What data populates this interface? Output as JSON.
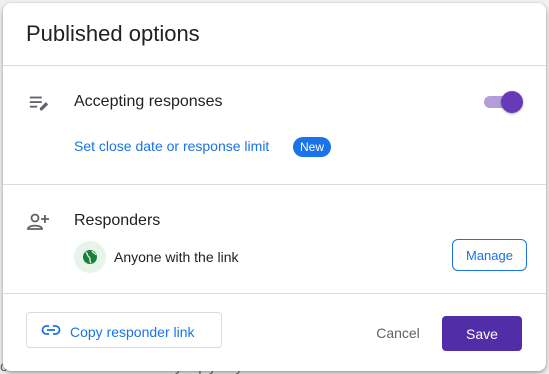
{
  "backdrop": {
    "partial_text": "our email address so we may reply to your comment"
  },
  "dialog": {
    "title": "Published options",
    "accepting": {
      "label": "Accepting responses",
      "toggle_on": true,
      "icon": "edit-list-icon",
      "close_date_link": "Set close date or response limit",
      "badge": "New"
    },
    "responders": {
      "label": "Responders",
      "icon": "person-add-icon",
      "access": "Anyone with the link",
      "access_icon": "globe-icon",
      "manage_label": "Manage"
    },
    "footer": {
      "copy_label": "Copy responder link",
      "copy_icon": "link-icon",
      "cancel_label": "Cancel",
      "save_label": "Save"
    }
  },
  "colors": {
    "accent": "#673ab7",
    "save": "#512da8",
    "link": "#1a73e8"
  }
}
